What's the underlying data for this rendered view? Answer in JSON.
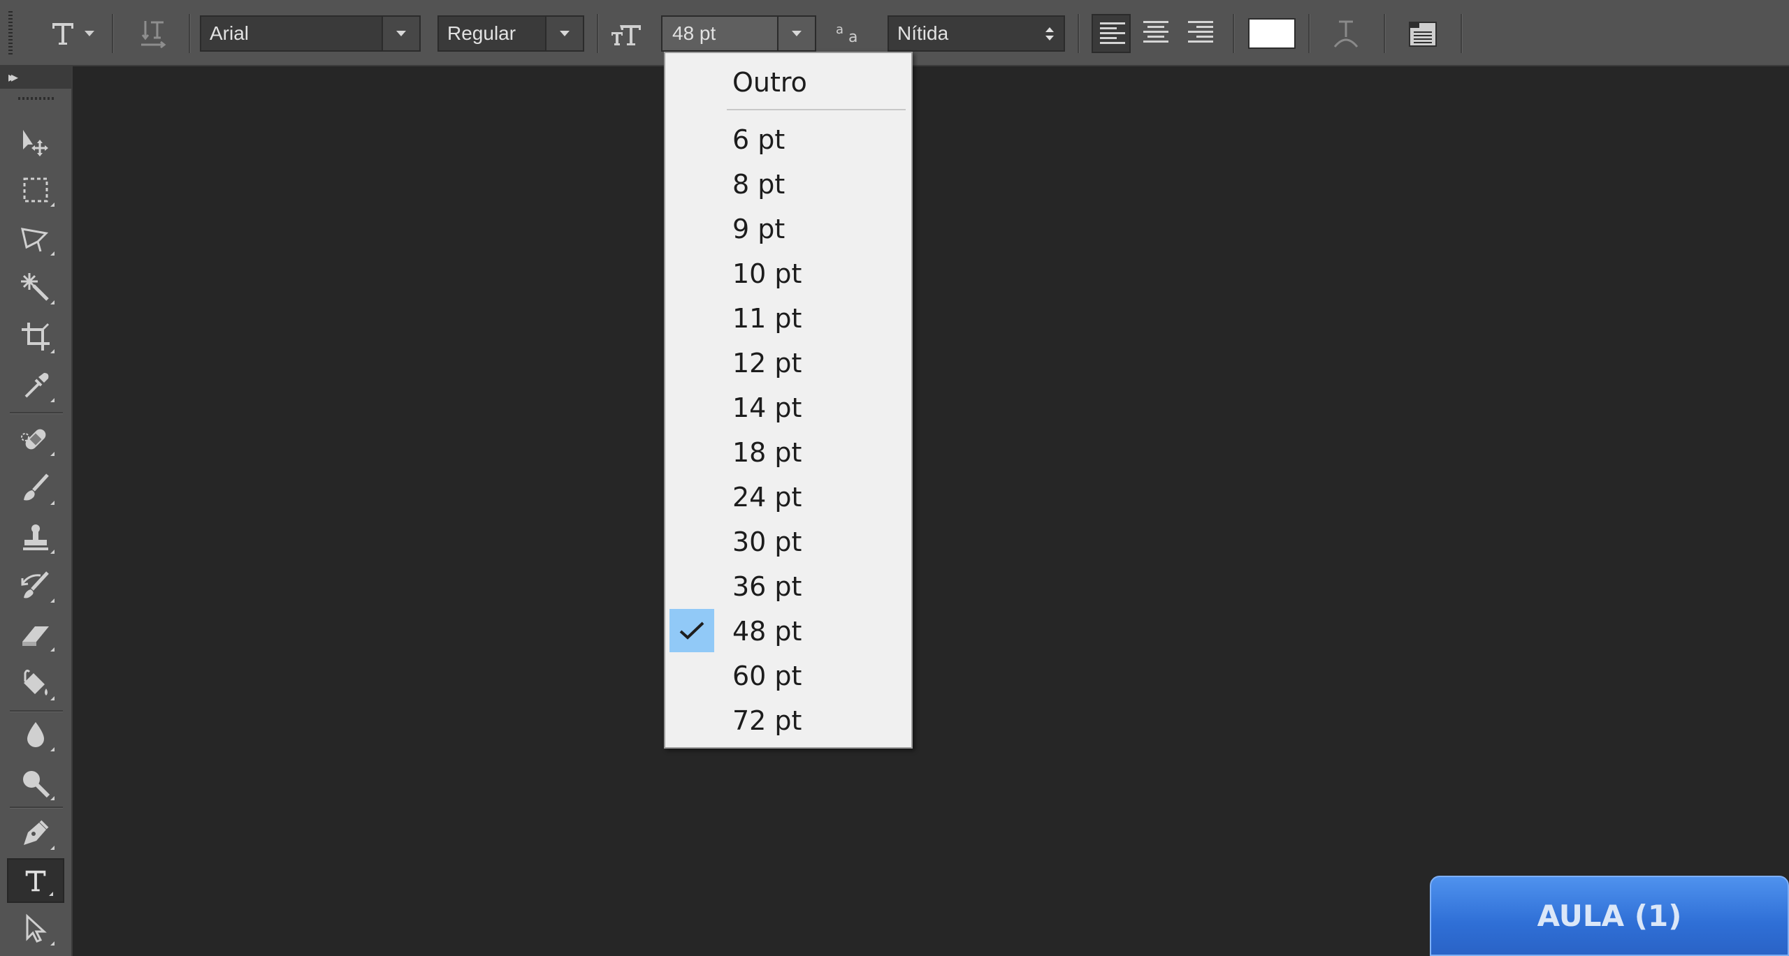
{
  "options_bar": {
    "tool_preset_icon": "type-T-icon",
    "orientation_icon": "text-orientation-icon",
    "font_family": "Arial",
    "font_style": "Regular",
    "font_size_icon": "font-size-icon",
    "font_size": "48 pt",
    "antialias_icon": "antialias-aa-icon",
    "antialias": "Nítida",
    "align_buttons": [
      "align-left-icon",
      "align-center-icon",
      "align-right-icon"
    ],
    "selected_align": "align-left",
    "text_color": "#ffffff",
    "warp_icon": "warp-text-icon",
    "panels_icon": "character-paragraph-panels-icon"
  },
  "tools_panel": {
    "tools": [
      "move-tool-icon",
      "rectangular-marquee-icon",
      "polygonal-lasso-icon",
      "magic-wand-icon",
      "crop-tool-icon",
      "eyedropper-icon",
      "spot-healing-icon",
      "brush-tool-icon",
      "clone-stamp-icon",
      "history-brush-icon",
      "eraser-tool-icon",
      "paint-bucket-icon",
      "blur-tool-icon",
      "dodge-tool-icon",
      "pen-tool-icon",
      "type-tool-icon",
      "path-selection-icon"
    ],
    "selected_tool": "type-tool-icon"
  },
  "font_size_menu": {
    "other_label": "Outro",
    "sizes": [
      "6 pt",
      "8 pt",
      "9 pt",
      "10 pt",
      "11 pt",
      "12 pt",
      "14 pt",
      "18 pt",
      "24 pt",
      "30 pt",
      "36 pt",
      "48 pt",
      "60 pt",
      "72 pt"
    ],
    "checked": "48 pt",
    "check_color": "#91c9f7"
  },
  "badge": {
    "label": "AULA (1)",
    "color": "#2f6fd6"
  }
}
